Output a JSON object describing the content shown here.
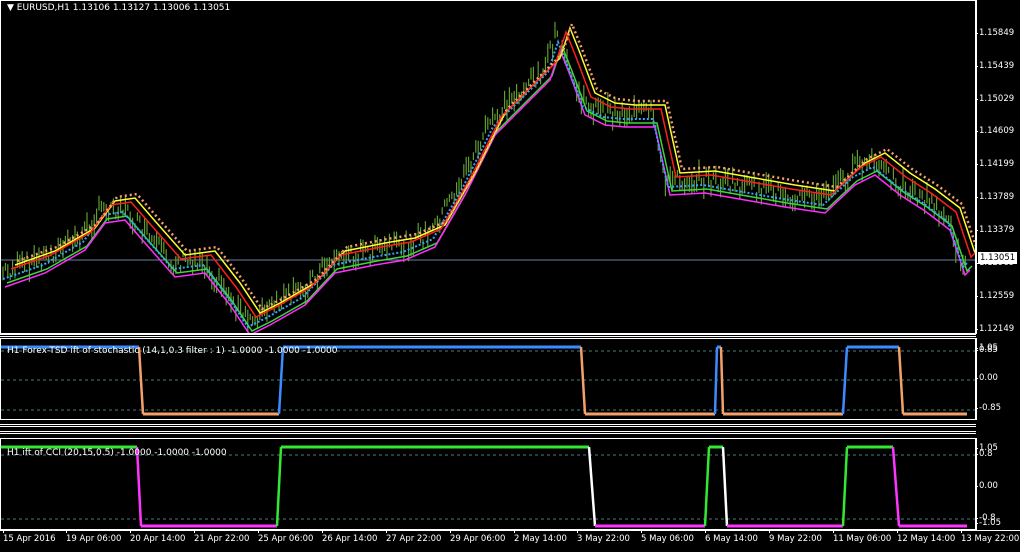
{
  "main": {
    "symbol": "EURUSD,H1",
    "ohlc": "1.13106 1.13127 1.13006 1.13051",
    "current_price": "1.13051",
    "price_ticks": [
      "1.15849",
      "1.15439",
      "1.15029",
      "1.14609",
      "1.14199",
      "1.13789",
      "1.13379",
      "1.12969",
      "1.12559",
      "1.12149"
    ]
  },
  "sub1": {
    "title": "H1 Forex-TSD ift of stochastic (14,1,0.3 filter : 1) -1.0000 -1.0000 -1.0000",
    "ticks": [
      "0.85",
      "0.00",
      "-0.85"
    ],
    "tick_top2": "1.05"
  },
  "sub2": {
    "title": "H1 ift of CCI (20,15,0.5) -1.0000 -1.0000 -1.0000",
    "ticks": [
      "1.05",
      "0.8",
      "0.00",
      "-0.8",
      "-1.05"
    ]
  },
  "time_labels": [
    "15 Apr 2016",
    "19 Apr 06:00",
    "20 Apr 14:00",
    "21 Apr 22:00",
    "25 Apr 06:00",
    "26 Apr 14:00",
    "27 Apr 22:00",
    "29 Apr 06:00",
    "2 May 14:00",
    "3 May 22:00",
    "5 May 06:00",
    "6 May 14:00",
    "9 May 22:00",
    "11 May 06:00",
    "12 May 14:00",
    "13 May 22:00"
  ],
  "colors": {
    "candles": "#5f9d2f",
    "line_blue": "#2fa8ff",
    "line_green": "#3fd43f",
    "line_magenta": "#ff2cff",
    "line_yellow": "#ffff2f",
    "line_red": "#ff1e1e",
    "line_salmon": "#f4a06a",
    "stoch_up": "#3a8cff",
    "stoch_down": "#f4a06a",
    "cci_up": "#32e832",
    "cci_down": "#ff35ff",
    "cci_neutral": "#ffffff"
  }
}
